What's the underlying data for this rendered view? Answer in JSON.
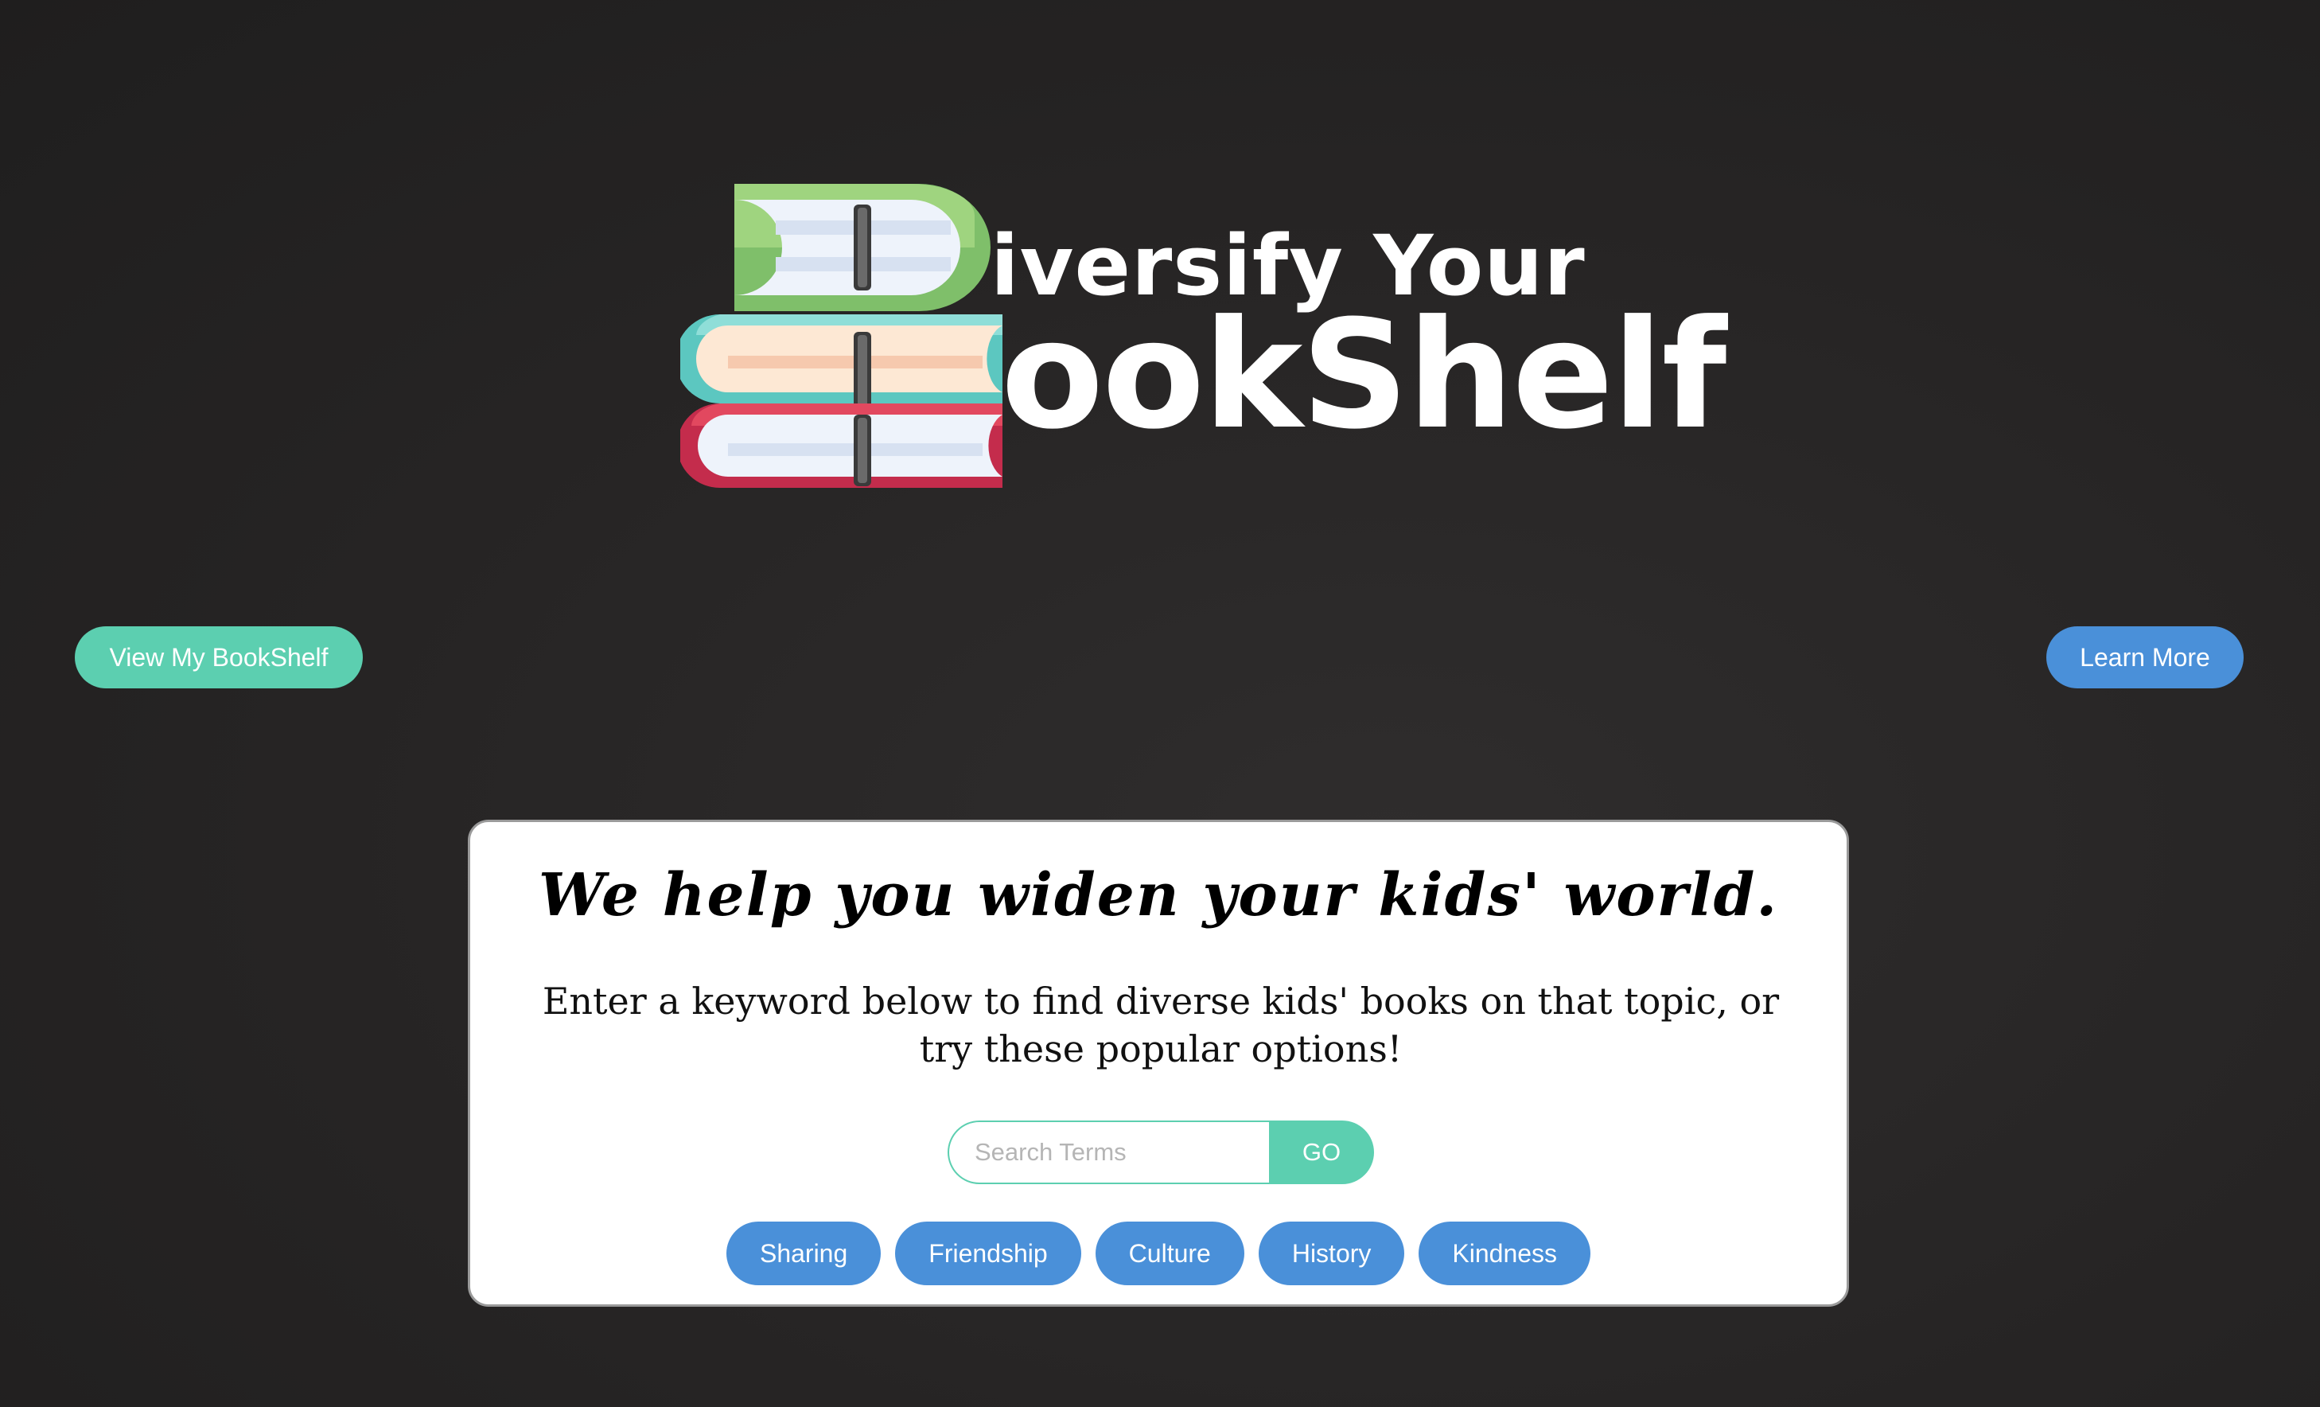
{
  "logo": {
    "line1": "iversify Your",
    "line2": "ookShelf"
  },
  "nav": {
    "bookshelf_label": "View My BookShelf",
    "learn_more_label": "Learn More"
  },
  "hero": {
    "title": "We help you widen your kids' world.",
    "subtitle": "Enter a keyword below to find diverse kids' books on that topic, or try these popular options!"
  },
  "search": {
    "placeholder": "Search Terms",
    "value": "",
    "go_label": "GO"
  },
  "popular_tags": [
    "Sharing",
    "Friendship",
    "Culture",
    "History",
    "Kindness"
  ],
  "colors": {
    "teal": "#5ccfb0",
    "blue": "#4a90d9",
    "background": "#262424",
    "book_green": "#7fbf6a",
    "book_teal": "#5cc7c0",
    "book_red": "#d6405a"
  },
  "icons": {
    "logo": "book-stack-icon"
  }
}
